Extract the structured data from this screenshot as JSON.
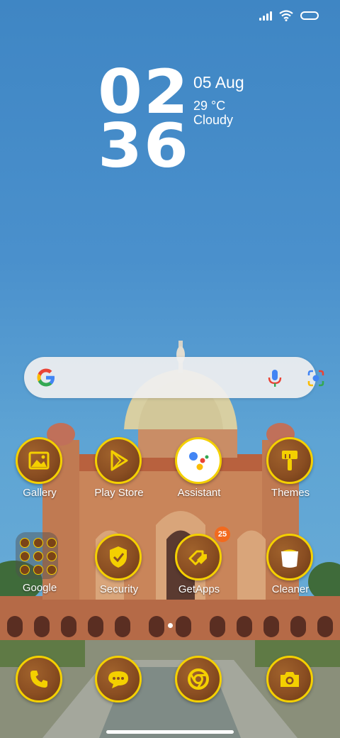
{
  "clock": {
    "hour": "02",
    "minute": "36"
  },
  "date": "05 Aug",
  "weather": {
    "temp": "29 °C",
    "condition": "Cloudy"
  },
  "search": {
    "logo": "google-g-icon",
    "mic": "mic-icon",
    "lens": "lens-icon"
  },
  "apps_row1": [
    {
      "label": "Gallery",
      "icon": "gallery-icon"
    },
    {
      "label": "Play Store",
      "icon": "play-store-icon"
    },
    {
      "label": "Assistant",
      "icon": "assistant-icon"
    },
    {
      "label": "Themes",
      "icon": "themes-icon"
    }
  ],
  "apps_row2": [
    {
      "label": "Google",
      "icon": "folder-icon"
    },
    {
      "label": "Security",
      "icon": "security-icon"
    },
    {
      "label": "GetApps",
      "icon": "getapps-icon",
      "badge": "25"
    },
    {
      "label": "Cleaner",
      "icon": "cleaner-icon"
    }
  ],
  "dock": [
    {
      "icon": "phone-icon"
    },
    {
      "icon": "messages-icon"
    },
    {
      "icon": "chrome-icon"
    },
    {
      "icon": "camera-icon"
    }
  ],
  "colors": {
    "icon_ring": "#f4d000",
    "icon_fill": "#8a4e22",
    "badge": "#f26a1e"
  }
}
